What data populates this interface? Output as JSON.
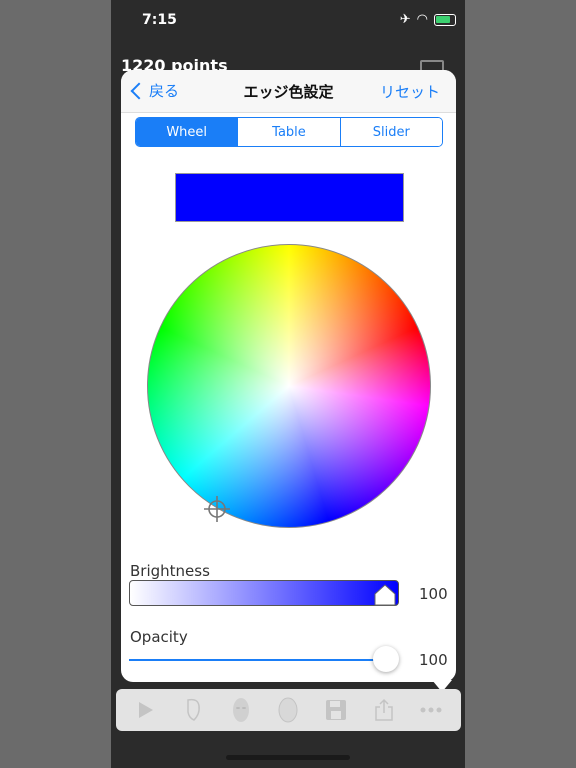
{
  "status": {
    "time": "7:15"
  },
  "background": {
    "title": "1220 points"
  },
  "navbar": {
    "back_label": "戻る",
    "title": "エッジ色設定",
    "reset_label": "リセット"
  },
  "tabs": [
    {
      "label": "Wheel",
      "active": true
    },
    {
      "label": "Table",
      "active": false
    },
    {
      "label": "Slider",
      "active": false
    }
  ],
  "color": {
    "selected": "#0000ff",
    "accent": "#1a7ef7"
  },
  "brightness": {
    "label": "Brightness",
    "value": "100"
  },
  "opacity": {
    "label": "Opacity",
    "value": "100"
  },
  "toolbar": {
    "items": [
      "play-icon",
      "face-outline-icon",
      "mask-icon",
      "head-icon",
      "save-icon",
      "share-icon",
      "more-icon"
    ]
  }
}
